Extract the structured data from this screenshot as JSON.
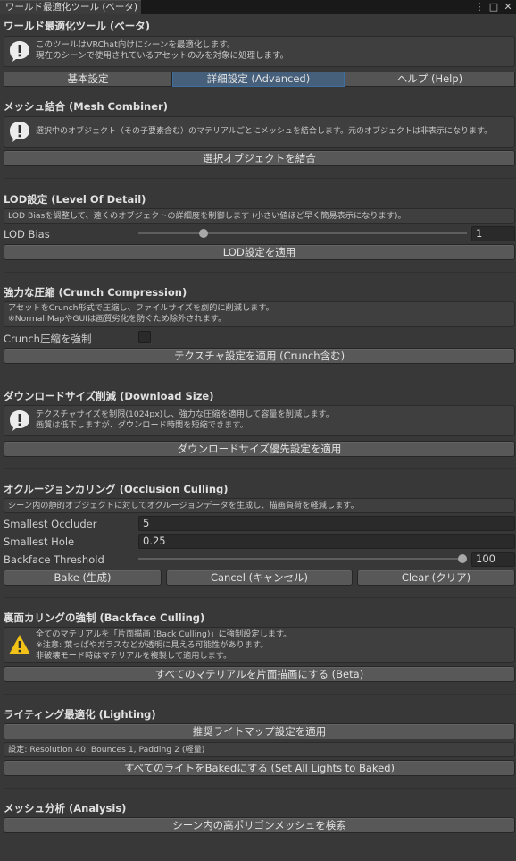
{
  "window": {
    "tab_title": "ワールド最適化ツール (ベータ)",
    "menu_glyph": "⋮",
    "maximize_glyph": "□",
    "close_glyph": "✕"
  },
  "header": {
    "title": "ワールド最適化ツール (ベータ)",
    "info_lines": [
      "このツールはVRChat向けにシーンを最適化します。",
      "現在のシーンで使用されているアセットのみを対象に処理します。"
    ]
  },
  "tabs": [
    {
      "label": "基本設定",
      "selected": false
    },
    {
      "label": "詳細設定 (Advanced)",
      "selected": true
    },
    {
      "label": "ヘルプ (Help)",
      "selected": false
    }
  ],
  "mesh_combiner": {
    "title": "メッシュ結合 (Mesh Combiner)",
    "info": "選択中のオブジェクト（その子要素含む）のマテリアルごとにメッシュを結合します。元のオブジェクトは非表示になります。",
    "button": "選択オブジェクトを結合"
  },
  "lod": {
    "title": "LOD設定 (Level Of Detail)",
    "info": "LOD Biasを調整して、遠くのオブジェクトの詳細度を制御します (小さい値ほど早く簡易表示になります)。",
    "bias_label": "LOD Bias",
    "bias_value": "1",
    "bias_fraction": 0.19,
    "button": "LOD設定を適用"
  },
  "crunch": {
    "title": "強力な圧縮 (Crunch Compression)",
    "info_lines": [
      "アセットをCrunch形式で圧縮し、ファイルサイズを劇的に削減します。",
      "※Normal MapやGUIは画質劣化を防ぐため除外されます。"
    ],
    "toggle_label": "Crunch圧縮を強制",
    "toggle_checked": false,
    "button": "テクスチャ設定を適用 (Crunch含む)"
  },
  "download": {
    "title": "ダウンロードサイズ削減 (Download Size)",
    "info_lines": [
      "テクスチャサイズを制限(1024px)し、強力な圧縮を適用して容量を削減します。",
      "画質は低下しますが、ダウンロード時間を短縮できます。"
    ],
    "button": "ダウンロードサイズ優先設定を適用"
  },
  "occlusion": {
    "title": "オクルージョンカリング (Occlusion Culling)",
    "info": "シーン内の静的オブジェクトに対してオクルージョンデータを生成し、描画負荷を軽減します。",
    "fields": [
      {
        "label": "Smallest Occluder",
        "value": "5"
      },
      {
        "label": "Smallest Hole",
        "value": "0.25"
      }
    ],
    "threshold_label": "Backface Threshold",
    "threshold_value": "100",
    "threshold_fraction": 1.0,
    "buttons": [
      "Bake (生成)",
      "Cancel (キャンセル)",
      "Clear (クリア)"
    ]
  },
  "backface": {
    "title": "裏面カリングの強制 (Backface Culling)",
    "info_lines": [
      "全てのマテリアルを「片面描画 (Back Culling)」に強制設定します。",
      "※注意: 葉っぱやガラスなどが透明に見える可能性があります。",
      "非破壊モード時はマテリアルを複製して適用します。"
    ],
    "button": "すべてのマテリアルを片面描画にする (Beta)"
  },
  "lighting": {
    "title": "ライティング最適化 (Lighting)",
    "button_lightmap": "推奨ライトマップ設定を適用",
    "settings_text": "設定: Resolution 40, Bounces 1, Padding 2 (軽量)",
    "button_baked": "すべてのライトをBakedにする (Set All Lights to Baked)"
  },
  "analysis": {
    "title": "メッシュ分析 (Analysis)",
    "button": "シーン内の高ポリゴンメッシュを検索"
  },
  "colors": {
    "background": "#383838",
    "button": "#585858",
    "selected_tab": "#46607c",
    "warning": "#f2c218"
  }
}
